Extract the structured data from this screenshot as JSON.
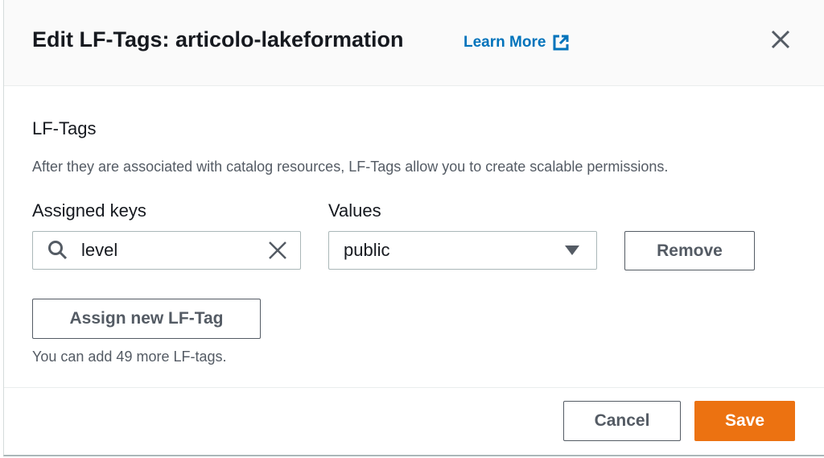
{
  "dialog": {
    "title": "Edit LF-Tags: articolo-lakeformation",
    "learn_more": "Learn More",
    "section_title": "LF-Tags",
    "description": "After they are associated with catalog resources, LF-Tags allow you to create scalable permissions.",
    "assigned_keys_label": "Assigned keys",
    "values_label": "Values",
    "key_value": "level",
    "value_selected": "public",
    "remove_label": "Remove",
    "assign_label": "Assign new LF-Tag",
    "hint": "You can add 49 more LF-tags.",
    "cancel_label": "Cancel",
    "save_label": "Save"
  },
  "colors": {
    "accent": "#ec7211",
    "link": "#0073bb"
  }
}
